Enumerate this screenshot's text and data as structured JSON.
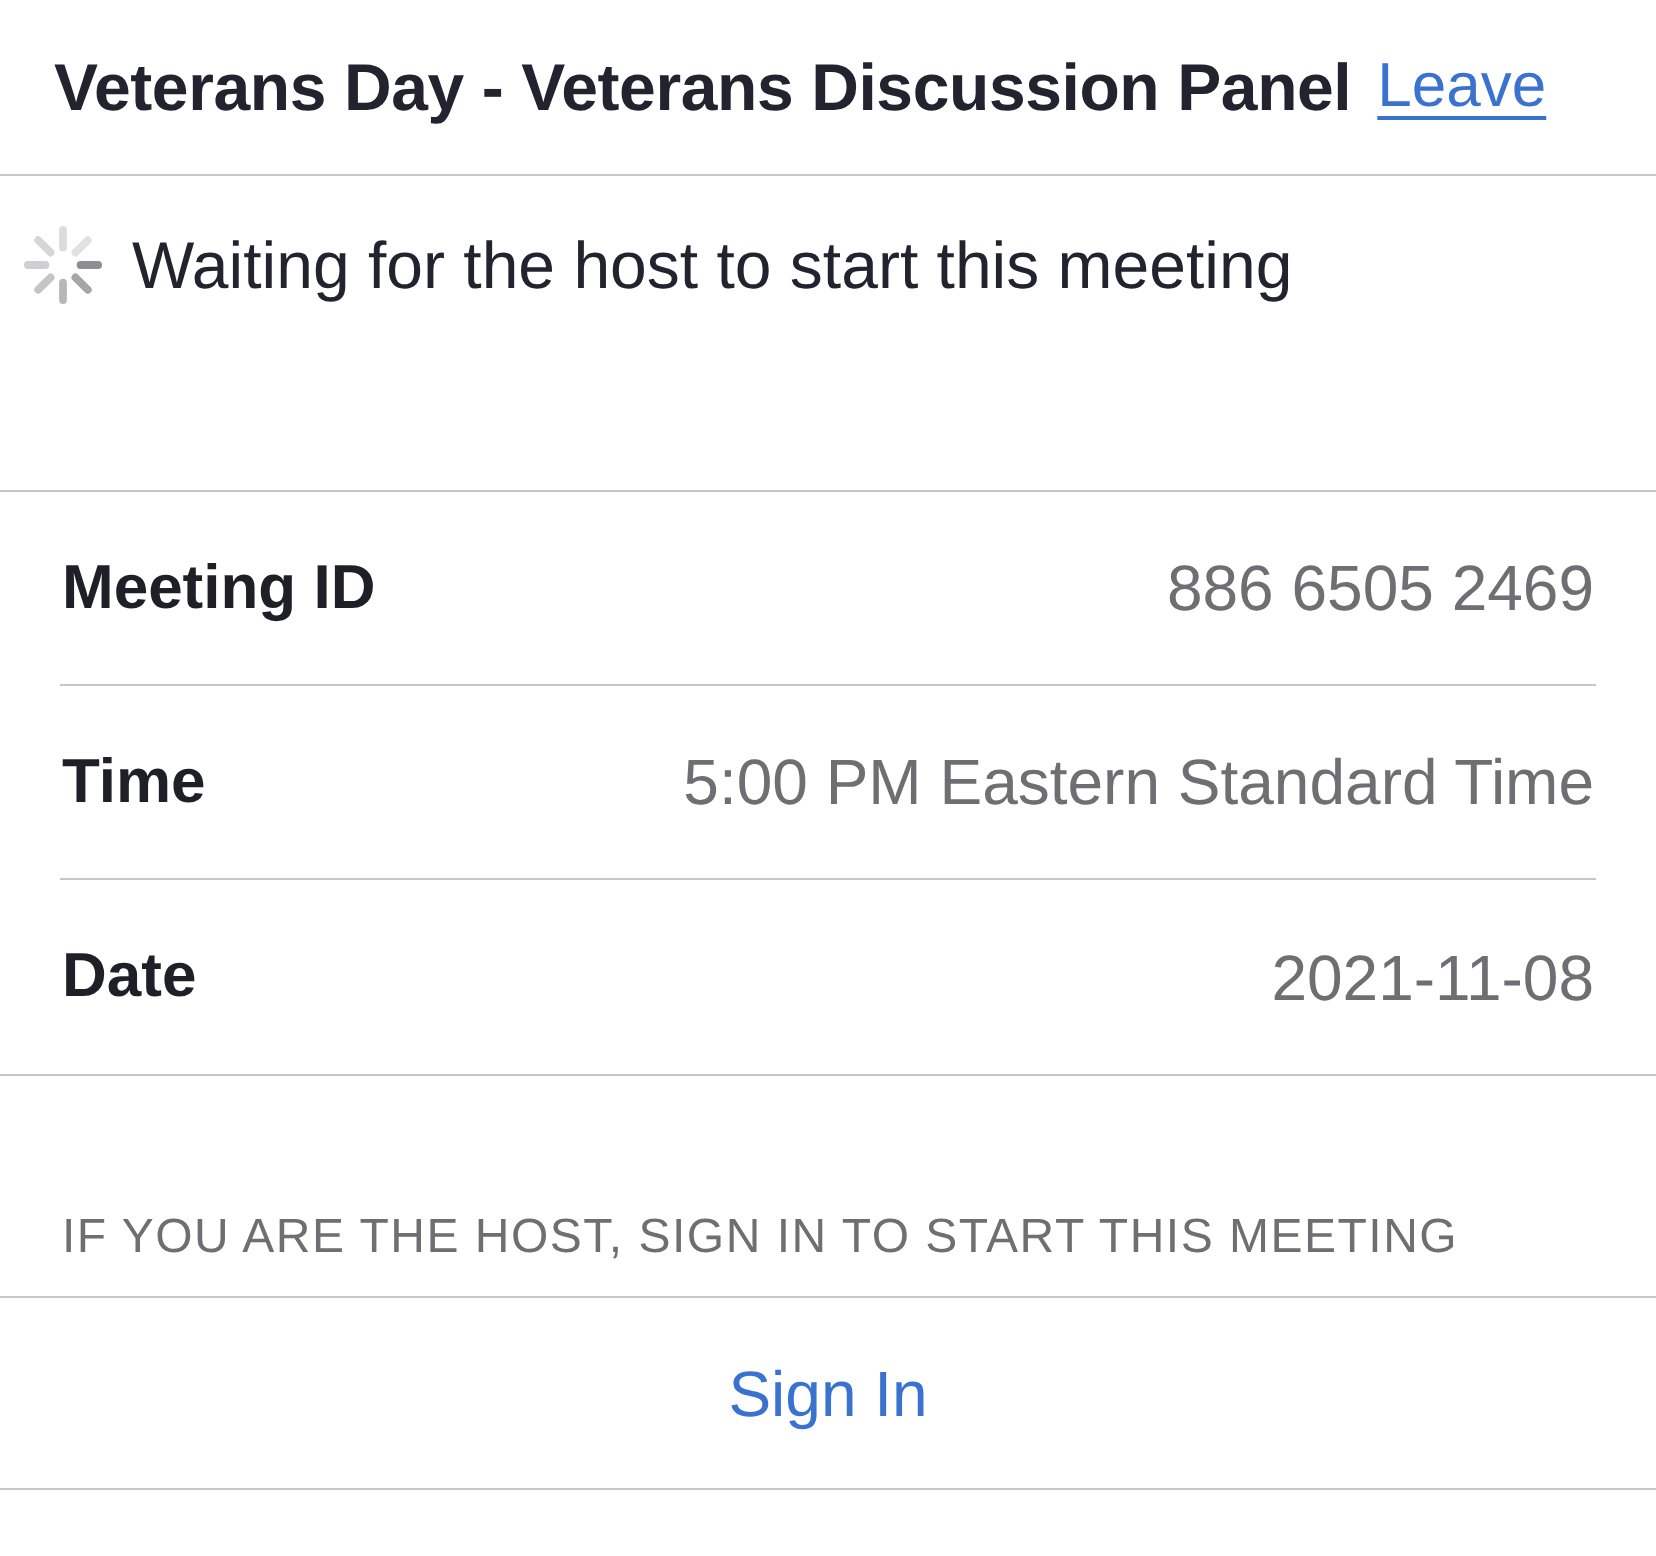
{
  "header": {
    "title": "Veterans Day - Veterans Discussion Panel",
    "leave_link": "Leave"
  },
  "status": {
    "message": "Waiting for the host to start this meeting"
  },
  "details": [
    {
      "label": "Meeting ID",
      "value": "886 6505 2469"
    },
    {
      "label": "Time",
      "value": "5:00 PM Eastern Standard Time"
    },
    {
      "label": "Date",
      "value": "2021-11-08"
    }
  ],
  "host_section": {
    "header": "IF YOU ARE THE HOST, SIGN IN TO START THIS MEETING",
    "button": "Sign In"
  }
}
